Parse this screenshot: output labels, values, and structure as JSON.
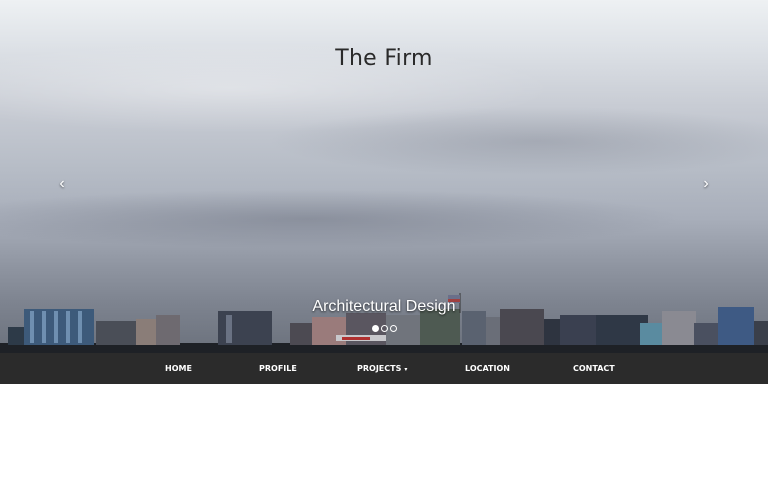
{
  "hero": {
    "title": "The Firm",
    "slide_caption": "Architectural Design",
    "prev_glyph": "‹",
    "next_glyph": "›",
    "slide_count": 3,
    "active_slide": 1,
    "prev_icon": "chevron-left-icon",
    "next_icon": "chevron-right-icon"
  },
  "nav": {
    "items": [
      {
        "label": "HOME"
      },
      {
        "label": "PROFILE"
      },
      {
        "label": "PROJECTS",
        "has_dropdown": true,
        "caret": "▾"
      },
      {
        "label": "LOCATION"
      },
      {
        "label": "CONTACT"
      }
    ]
  },
  "colors": {
    "navbar_bg": "#2b2b2b",
    "nav_text": "#ffffff",
    "page_bg": "#ffffff"
  }
}
